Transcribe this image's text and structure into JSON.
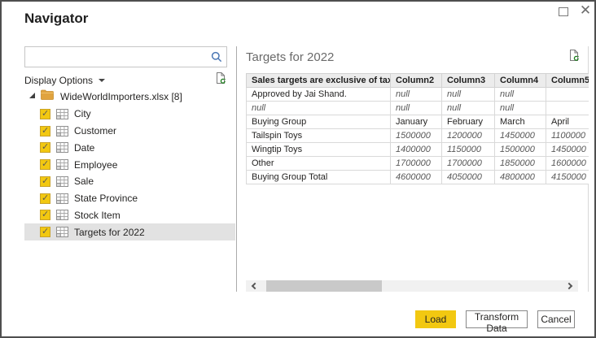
{
  "window": {
    "title": "Navigator"
  },
  "left_panel": {
    "search": {
      "value": "",
      "placeholder": ""
    },
    "display_options_label": "Display Options",
    "tree": {
      "root": {
        "label": "WideWorldImporters.xlsx [8]",
        "expanded": true
      },
      "items": [
        {
          "label": "City",
          "checked": true,
          "selected": false
        },
        {
          "label": "Customer",
          "checked": true,
          "selected": false
        },
        {
          "label": "Date",
          "checked": true,
          "selected": false
        },
        {
          "label": "Employee",
          "checked": true,
          "selected": false
        },
        {
          "label": "Sale",
          "checked": true,
          "selected": false
        },
        {
          "label": "State Province",
          "checked": true,
          "selected": false
        },
        {
          "label": "Stock Item",
          "checked": true,
          "selected": false
        },
        {
          "label": "Targets for 2022",
          "checked": true,
          "selected": true
        }
      ]
    }
  },
  "preview": {
    "title": "Targets for 2022",
    "table": {
      "columns": [
        "Sales targets are exclusive of tax.",
        "Column2",
        "Column3",
        "Column4",
        "Column5"
      ],
      "rows": [
        {
          "cells": [
            "Approved by Jai Shand.",
            "null",
            "null",
            "null",
            ""
          ],
          "types": [
            "text",
            "null",
            "null",
            "null",
            "empty"
          ]
        },
        {
          "cells": [
            "null",
            "null",
            "null",
            "null",
            ""
          ],
          "types": [
            "null",
            "null",
            "null",
            "null",
            "empty"
          ]
        },
        {
          "cells": [
            "Buying Group",
            "January",
            "February",
            "March",
            "April"
          ],
          "types": [
            "text",
            "text",
            "text",
            "text",
            "text"
          ]
        },
        {
          "cells": [
            "Tailspin Toys",
            "1500000",
            "1200000",
            "1450000",
            "1100000"
          ],
          "types": [
            "text",
            "num",
            "num",
            "num",
            "num"
          ]
        },
        {
          "cells": [
            "Wingtip Toys",
            "1400000",
            "1150000",
            "1500000",
            "1450000"
          ],
          "types": [
            "text",
            "num",
            "num",
            "num",
            "num"
          ]
        },
        {
          "cells": [
            "Other",
            "1700000",
            "1700000",
            "1850000",
            "1600000"
          ],
          "types": [
            "text",
            "num",
            "num",
            "num",
            "num"
          ]
        },
        {
          "cells": [
            "Buying Group Total",
            "4600000",
            "4050000",
            "4800000",
            "4150000"
          ],
          "types": [
            "text",
            "num",
            "num",
            "num",
            "num"
          ]
        }
      ]
    }
  },
  "footer": {
    "load_label": "Load",
    "transform_label": "Transform Data",
    "cancel_label": "Cancel"
  },
  "colors": {
    "accent_yellow": "#F2C811",
    "selected_row": "#e2e2e2",
    "table_header_bg": "#ececec",
    "null_text": "#575757",
    "search_icon_blue": "#4a77b4",
    "refresh_green": "#1c7f1c"
  }
}
